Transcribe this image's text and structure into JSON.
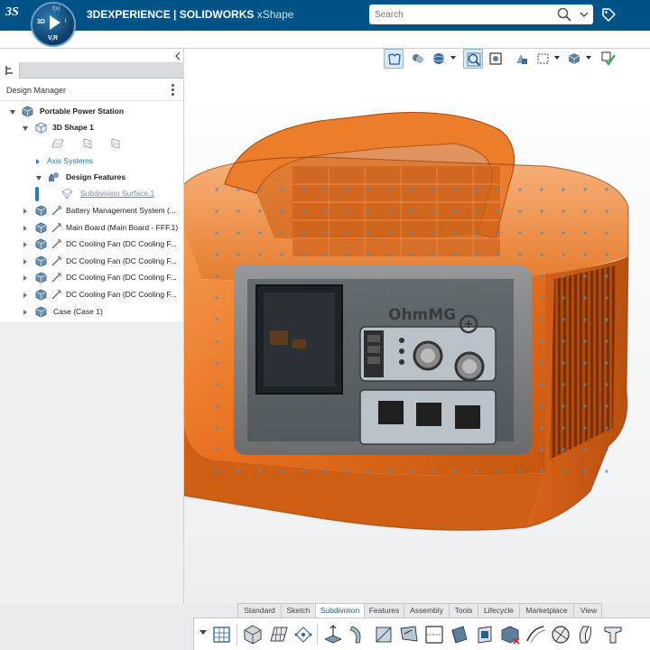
{
  "header": {
    "brand_bold": "3DEXPERIENCE | SOLIDWORKS",
    "brand_light": "xShape",
    "compass_center": "3D",
    "compass_right": "i",
    "compass_bottom": "V,R",
    "search_placeholder": "Search"
  },
  "design_manager": {
    "title": "Design Manager",
    "tree": {
      "root": "Portable Power Station",
      "shape": "3D Shape 1",
      "axis_systems": "Axis Systems",
      "design_features": "Design Features",
      "subdivision_surface": "Subdivision Surface.1",
      "items": [
        "Battery Management System (...",
        "Main Board (Main Board - FFF.1)",
        "DC Cooling Fan (DC Cooling F...",
        "DC Cooling Fan (DC Cooling F...",
        "DC Cooling Fan (DC Cooling F...",
        "DC Cooling Fan (DC Cooling F..."
      ],
      "case": "Case (Case 1)"
    }
  },
  "viewport": {
    "model_brand_label": "OhmMG",
    "model_color": "#e8711f"
  },
  "action_bar": {
    "tabs": [
      "Standard",
      "Sketch",
      "Subdivision",
      "Features",
      "Assembly",
      "Tools",
      "Lifecycle",
      "Marketplace",
      "View"
    ],
    "active_tab": "Subdivision"
  },
  "colors": {
    "topbar": "#005386",
    "accent_blue": "#2a7ab8",
    "orange": "#e8711f"
  }
}
